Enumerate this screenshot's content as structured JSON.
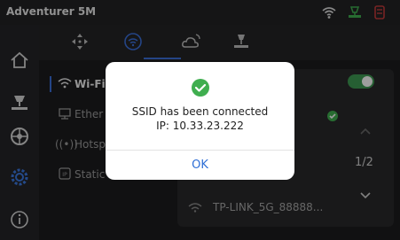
{
  "status_bar": {
    "title": "Adventurer 5M",
    "icons": [
      "wifi-icon",
      "printer-status-icon",
      "filament-icon"
    ],
    "colors": {
      "wifi": "#dcdcdc",
      "printer": "#3fae4f",
      "filament": "#c23a3a"
    }
  },
  "sidebar": {
    "items": [
      "home-icon",
      "print-icon",
      "filament-icon",
      "settings-icon",
      "info-icon"
    ],
    "active": "settings-icon"
  },
  "tabs": {
    "items": [
      "move-icon",
      "network-icon",
      "cloud-icon",
      "printer-settings-icon"
    ],
    "active": "network-icon"
  },
  "menu": {
    "items": [
      {
        "label": "Wi-Fi",
        "icon": "wifi-icon",
        "active": true
      },
      {
        "label": "Ether",
        "icon": "ethernet-icon",
        "active": false
      },
      {
        "label": "Hotsp",
        "icon": "hotspot-icon",
        "active": false
      },
      {
        "label": "Static",
        "icon": "ip-icon",
        "active": false
      }
    ]
  },
  "network_panel": {
    "wifi_enabled": true,
    "page_indicator": "1/2",
    "visible_network": "TP-LINK_5G_88888..."
  },
  "dialog": {
    "message_line1": "SSID has been connected",
    "message_line2": "IP: 10.33.23.222",
    "ok_label": "OK",
    "accent": "#2f6fd6",
    "success_color": "#3fae4f"
  }
}
